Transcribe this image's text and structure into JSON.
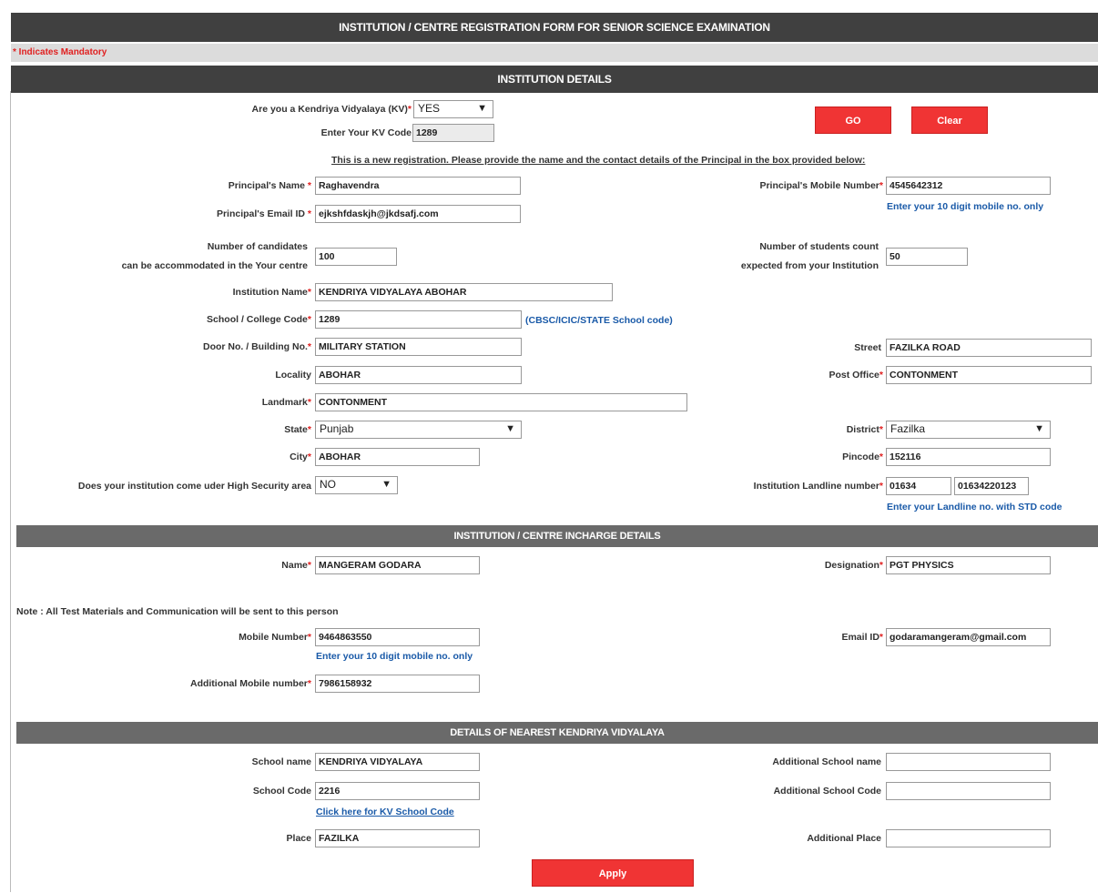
{
  "form": {
    "title": "INSTITUTION / CENTRE REGISTRATION FORM FOR SENIOR SCIENCE EXAMINATION",
    "mandatory_note": "* Indicates Mandatory"
  },
  "sections": {
    "institution": "INSTITUTION DETAILS",
    "incharge": "INSTITUTION / CENTRE INCHARGE DETAILS",
    "nearest_kv": "DETAILS OF NEAREST KENDRIYA VIDYALAYA"
  },
  "kv": {
    "question": "Are you a Kendriya Vidyalaya (KV)",
    "selected": "YES",
    "code_label": "Enter Your KV Code",
    "code_value": "1289"
  },
  "buttons": {
    "go": "GO",
    "clear": "Clear",
    "apply": "Apply"
  },
  "notice": "This is a new registration. Please provide the name and the contact details of the Principal in the box provided below:",
  "institution": {
    "principal_name_label": "Principal's Name",
    "principal_name": "Raghavendra",
    "principal_email_label": "Principal's Email ID",
    "principal_email": "ejkshfdaskjh@jkdsafj.com",
    "principal_mobile_label": "Principal's Mobile Number",
    "principal_mobile": "4545642312",
    "mobile_hint": "Enter your 10 digit mobile no. only",
    "candidates_label_1": "Number of candidates",
    "candidates_label_2": "can be accommodated in the Your centre",
    "candidates": "100",
    "students_label_1": "Number of students count",
    "students_label_2": "expected from your Institution",
    "students": "50",
    "inst_name_label": "Institution Name",
    "inst_name": "KENDRIYA VIDYALAYA ABOHAR",
    "school_code_label": "School / College Code",
    "school_code": "1289",
    "school_code_hint": "(CBSC/ICIC/STATE School code)",
    "door_label": "Door No. / Building No.",
    "door": "MILITARY STATION",
    "street_label": "Street",
    "street": "FAZILKA ROAD",
    "locality_label": "Locality",
    "locality": "ABOHAR",
    "post_office_label": "Post Office",
    "post_office": "CONTONMENT",
    "landmark_label": "Landmark",
    "landmark": "CONTONMENT",
    "state_label": "State",
    "state": "Punjab",
    "district_label": "District",
    "district": "Fazilka",
    "city_label": "City",
    "city": "ABOHAR",
    "pincode_label": "Pincode",
    "pincode": "152116",
    "security_label": "Does your institution come uder High Security area",
    "security": "NO",
    "landline_label": "Institution Landline number",
    "landline_std": "01634",
    "landline_no": "01634220123",
    "landline_hint": "Enter your Landline no. with STD code"
  },
  "incharge": {
    "name_label": "Name",
    "name": "MANGERAM GODARA",
    "designation_label": "Designation",
    "designation": "PGT PHYSICS",
    "note": "Note : All Test Materials and Communication will be sent to this person",
    "mobile_label": "Mobile Number",
    "mobile": "9464863550",
    "mobile_hint": "Enter your 10 digit mobile no. only",
    "email_label": "Email ID",
    "email": "godaramangeram@gmail.com",
    "add_mobile_label": "Additional Mobile number",
    "add_mobile": "7986158932"
  },
  "nearest": {
    "school_name_label": "School name",
    "school_name": "KENDRIYA VIDYALAYA",
    "add_school_name_label": "Additional School name",
    "add_school_name": "",
    "school_code_label": "School Code",
    "school_code": "2216",
    "add_school_code_label": "Additional School Code",
    "add_school_code": "",
    "kv_code_link": "Click here for KV School Code",
    "place_label": "Place",
    "place": "FAZILKA",
    "add_place_label": "Additional Place",
    "add_place": ""
  },
  "colors": {
    "header_bg": "#404040",
    "section_bg": "#6a6a6a",
    "accent_red": "#f03434",
    "link_blue": "#1a5aa8",
    "mandatory_red": "#e02020"
  }
}
